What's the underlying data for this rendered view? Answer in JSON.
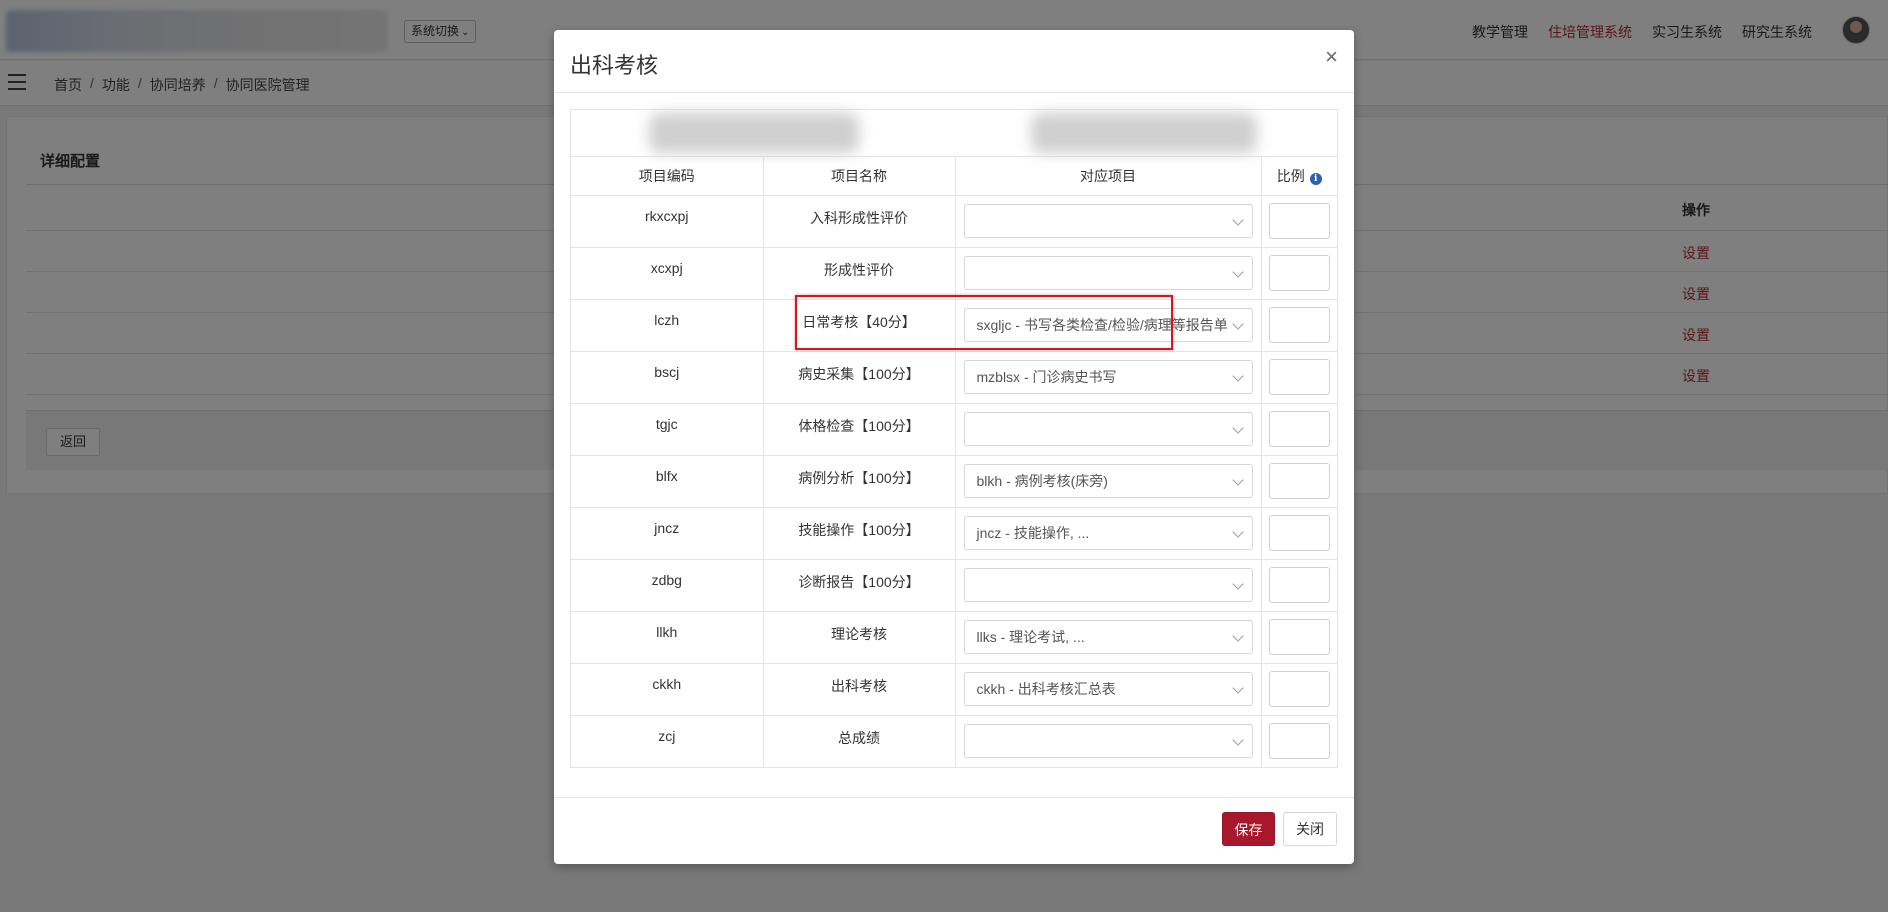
{
  "header": {
    "system_switch": "系统切换",
    "nav": [
      {
        "label": "教学管理",
        "active": false
      },
      {
        "label": "住培管理系统",
        "active": true
      },
      {
        "label": "实习生系统",
        "active": false
      },
      {
        "label": "研究生系统",
        "active": false
      }
    ],
    "active_color": "#b52c3a"
  },
  "breadcrumb": [
    "首页",
    "功能",
    "协同培养",
    "协同医院管理"
  ],
  "background": {
    "panel_title": "详细配置",
    "op_header": "操作",
    "row_action": "设置",
    "back_label": "返回"
  },
  "modal": {
    "title": "出科考核",
    "close_symbol": "×",
    "columns": {
      "code": "项目编码",
      "name": "项目名称",
      "mapping": "对应项目",
      "ratio": "比例"
    },
    "rows": [
      {
        "code": "rkxcxpj",
        "name": "入科形成性评价",
        "mapping": ""
      },
      {
        "code": "xcxpj",
        "name": "形成性评价",
        "mapping": ""
      },
      {
        "code": "lczh",
        "name": "日常考核【40分】",
        "mapping": "sxgljc - 书写各类检查/检验/病理等报告单"
      },
      {
        "code": "bscj",
        "name": "病史采集【100分】",
        "mapping": "mzblsx - 门诊病史书写"
      },
      {
        "code": "tgjc",
        "name": "体格检查【100分】",
        "mapping": ""
      },
      {
        "code": "blfx",
        "name": "病例分析【100分】",
        "mapping": "blkh - 病例考核(床旁)"
      },
      {
        "code": "jncz",
        "name": "技能操作【100分】",
        "mapping": "jncz - 技能操作,  ..."
      },
      {
        "code": "zdbg",
        "name": "诊断报告【100分】",
        "mapping": ""
      },
      {
        "code": "llkh",
        "name": "理论考核",
        "mapping": "llks - 理论考试,  ..."
      },
      {
        "code": "ckkh",
        "name": "出科考核",
        "mapping": "ckkh - 出科考核汇总表"
      },
      {
        "code": "zcj",
        "name": "总成绩",
        "mapping": ""
      }
    ],
    "save_label": "保存",
    "close_label": "关闭",
    "save_color": "#a8182c",
    "highlight_color": "#d6161e"
  }
}
